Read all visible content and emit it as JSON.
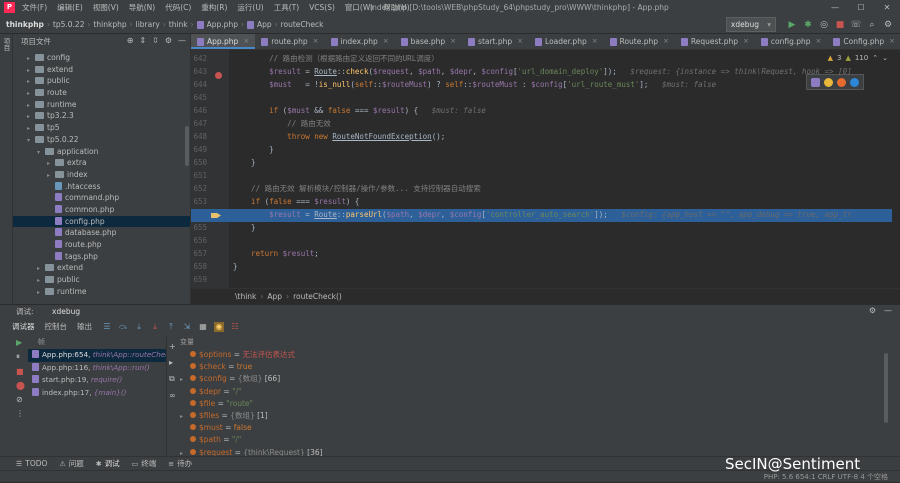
{
  "titlebar": {
    "menu": [
      "文件(F)",
      "编辑(E)",
      "视图(V)",
      "导航(N)",
      "代码(C)",
      "重构(R)",
      "运行(U)",
      "工具(T)",
      "VCS(S)",
      "窗口(W)",
      "帮助(H)"
    ],
    "title": "index.php [D:\\tools\\WEB\\phpStudy_64\\phpstudy_pro\\WWW\\thinkphp] - App.php",
    "min": "—",
    "max": "☐",
    "close": "✕"
  },
  "navbar": {
    "crumbs": [
      "thinkphp",
      "tp5.0.22",
      "thinkphp",
      "library",
      "think",
      "App.php",
      "App",
      "routeCheck"
    ],
    "config": "xdebug"
  },
  "project": {
    "label": "项目文件",
    "tree": [
      {
        "indent": 1,
        "name": "config",
        "type": "folder",
        "arrow": "▸"
      },
      {
        "indent": 1,
        "name": "extend",
        "type": "folder",
        "arrow": "▸"
      },
      {
        "indent": 1,
        "name": "public",
        "type": "folder",
        "arrow": "▸"
      },
      {
        "indent": 1,
        "name": "route",
        "type": "folder",
        "arrow": "▸"
      },
      {
        "indent": 1,
        "name": "runtime",
        "type": "folder",
        "arrow": "▸"
      },
      {
        "indent": 1,
        "name": "tp3.2.3",
        "type": "folder",
        "arrow": "▸"
      },
      {
        "indent": 1,
        "name": "tp5",
        "type": "folder",
        "arrow": "▸"
      },
      {
        "indent": 1,
        "name": "tp5.0.22",
        "type": "folder",
        "arrow": "▾"
      },
      {
        "indent": 2,
        "name": "application",
        "type": "folder",
        "arrow": "▾"
      },
      {
        "indent": 3,
        "name": "extra",
        "type": "folder",
        "arrow": "▸"
      },
      {
        "indent": 3,
        "name": "index",
        "type": "folder",
        "arrow": "▸"
      },
      {
        "indent": 3,
        "name": ".htaccess",
        "type": "file",
        "arrow": ""
      },
      {
        "indent": 3,
        "name": "command.php",
        "type": "php",
        "arrow": ""
      },
      {
        "indent": 3,
        "name": "common.php",
        "type": "php",
        "arrow": ""
      },
      {
        "indent": 3,
        "name": "config.php",
        "type": "php",
        "arrow": "",
        "selected": true
      },
      {
        "indent": 3,
        "name": "database.php",
        "type": "php",
        "arrow": ""
      },
      {
        "indent": 3,
        "name": "route.php",
        "type": "php",
        "arrow": ""
      },
      {
        "indent": 3,
        "name": "tags.php",
        "type": "php",
        "arrow": ""
      },
      {
        "indent": 2,
        "name": "extend",
        "type": "folder",
        "arrow": "▸"
      },
      {
        "indent": 2,
        "name": "public",
        "type": "folder",
        "arrow": "▸"
      },
      {
        "indent": 2,
        "name": "runtime",
        "type": "folder",
        "arrow": "▸"
      }
    ]
  },
  "tabs": [
    "App.php",
    "route.php",
    "index.php",
    "base.php",
    "start.php",
    "Loader.php",
    "Route.php",
    "Request.php",
    "config.php",
    "Config.php"
  ],
  "editor": {
    "inspect": {
      "warn": "3",
      "weak": "110"
    },
    "line_numbers": [
      "642",
      "643",
      "644",
      "645",
      "646",
      "647",
      "648",
      "649",
      "650",
      "651",
      "652",
      "653",
      "654",
      "655",
      "656",
      "657",
      "658",
      "659"
    ],
    "lines": [
      [
        {
          "c": "cmt",
          "t": "        // 路由检测（根据路由定义返回不同的URL调度）"
        }
      ],
      [
        {
          "c": "var",
          "t": "        $result"
        },
        {
          "c": "",
          "t": " = "
        },
        {
          "c": "cls",
          "t": "Route"
        },
        {
          "c": "",
          "t": "::"
        },
        {
          "c": "fn",
          "t": "check"
        },
        {
          "c": "",
          "t": "("
        },
        {
          "c": "var",
          "t": "$request"
        },
        {
          "c": "",
          "t": ", "
        },
        {
          "c": "var",
          "t": "$path"
        },
        {
          "c": "",
          "t": ", "
        },
        {
          "c": "var",
          "t": "$depr"
        },
        {
          "c": "",
          "t": ", "
        },
        {
          "c": "var",
          "t": "$config"
        },
        {
          "c": "",
          "t": "["
        },
        {
          "c": "str",
          "t": "'url_domain_deploy'"
        },
        {
          "c": "",
          "t": "]);   "
        },
        {
          "c": "hint",
          "t": "$request: {instance => think\\Request, hook => [0]"
        }
      ],
      [
        {
          "c": "var",
          "t": "        $must"
        },
        {
          "c": "",
          "t": "   = !"
        },
        {
          "c": "fn",
          "t": "is_null"
        },
        {
          "c": "",
          "t": "("
        },
        {
          "c": "kw",
          "t": "self"
        },
        {
          "c": "",
          "t": "::"
        },
        {
          "c": "var",
          "t": "$routeMust"
        },
        {
          "c": "",
          "t": ") ? "
        },
        {
          "c": "kw",
          "t": "self"
        },
        {
          "c": "",
          "t": "::"
        },
        {
          "c": "var",
          "t": "$routeMust"
        },
        {
          "c": "",
          "t": " : "
        },
        {
          "c": "var",
          "t": "$config"
        },
        {
          "c": "",
          "t": "["
        },
        {
          "c": "str",
          "t": "'url_route_must'"
        },
        {
          "c": "",
          "t": "];   "
        },
        {
          "c": "hint",
          "t": "$must: false"
        }
      ],
      [
        {
          "c": "",
          "t": ""
        }
      ],
      [
        {
          "c": "kw",
          "t": "        if"
        },
        {
          "c": "",
          "t": " ("
        },
        {
          "c": "var",
          "t": "$must"
        },
        {
          "c": "",
          "t": " && "
        },
        {
          "c": "kw",
          "t": "false"
        },
        {
          "c": "",
          "t": " === "
        },
        {
          "c": "var",
          "t": "$result"
        },
        {
          "c": "",
          "t": ") {   "
        },
        {
          "c": "hint",
          "t": "$must: false"
        }
      ],
      [
        {
          "c": "cmt",
          "t": "            // 路由无效"
        }
      ],
      [
        {
          "c": "kw",
          "t": "            throw new"
        },
        {
          "c": "",
          "t": " "
        },
        {
          "c": "cls",
          "t": "RouteNotFoundException"
        },
        {
          "c": "",
          "t": "();"
        }
      ],
      [
        {
          "c": "",
          "t": "        }"
        }
      ],
      [
        {
          "c": "",
          "t": "    }"
        }
      ],
      [
        {
          "c": "",
          "t": ""
        }
      ],
      [
        {
          "c": "cmt",
          "t": "    // 路由无效 解析模块/控制器/操作/参数... 支持控制器自动搜索"
        }
      ],
      [
        {
          "c": "kw",
          "t": "    if"
        },
        {
          "c": "",
          "t": " ("
        },
        {
          "c": "kw",
          "t": "false"
        },
        {
          "c": "",
          "t": " === "
        },
        {
          "c": "var",
          "t": "$result"
        },
        {
          "c": "",
          "t": ") {"
        }
      ],
      [
        {
          "c": "var",
          "t": "        $result"
        },
        {
          "c": "",
          "t": " = "
        },
        {
          "c": "cls",
          "t": "Route"
        },
        {
          "c": "",
          "t": "::"
        },
        {
          "c": "fn",
          "t": "parseUrl"
        },
        {
          "c": "",
          "t": "("
        },
        {
          "c": "var",
          "t": "$path"
        },
        {
          "c": "",
          "t": ", "
        },
        {
          "c": "var",
          "t": "$depr"
        },
        {
          "c": "",
          "t": ", "
        },
        {
          "c": "var",
          "t": "$config"
        },
        {
          "c": "",
          "t": "["
        },
        {
          "c": "str",
          "t": "'controller_auto_search'"
        },
        {
          "c": "",
          "t": "]);   "
        },
        {
          "c": "hintv",
          "t": "$config: {app_host => \"\", app_debug => true, app_tr"
        }
      ],
      [
        {
          "c": "",
          "t": "    }"
        }
      ],
      [
        {
          "c": "",
          "t": ""
        }
      ],
      [
        {
          "c": "kw",
          "t": "    return"
        },
        {
          "c": "",
          "t": " "
        },
        {
          "c": "var",
          "t": "$result"
        },
        {
          "c": "",
          "t": ";"
        }
      ],
      [
        {
          "c": "",
          "t": "}"
        }
      ],
      [
        {
          "c": "",
          "t": ""
        }
      ]
    ],
    "breadcrumb": [
      "\\think",
      "App",
      "routeCheck()"
    ]
  },
  "debug": {
    "label": "调试:",
    "session": "xdebug",
    "tool_tabs": [
      "调试器",
      "控制台",
      "输出"
    ],
    "frames_header": "帧",
    "frames": [
      {
        "loc": "App.php:654, ",
        "fn": "think\\App::routeCheck()",
        "selected": true
      },
      {
        "loc": "App.php:116, ",
        "fn": "think\\App::run()"
      },
      {
        "loc": "start.php:19, ",
        "fn": "require()"
      },
      {
        "loc": "index.php:17, ",
        "fn": "{main}()"
      }
    ],
    "vars_header": "变量",
    "vars": [
      {
        "expand": "",
        "name": "$options",
        "eq": " = ",
        "val": "无法评估表达式",
        "cls": "err"
      },
      {
        "expand": "",
        "name": "$check",
        "eq": " = ",
        "val": "true",
        "cls": "bool"
      },
      {
        "expand": "▸",
        "name": "$config",
        "eq": " = ",
        "type": "{数组} ",
        "val": "[66]",
        "cls": "arr"
      },
      {
        "expand": "",
        "name": "$depr",
        "eq": " = ",
        "val": "\"/\"",
        "cls": ""
      },
      {
        "expand": "",
        "name": "$file",
        "eq": " = ",
        "val": "\"route\"",
        "cls": ""
      },
      {
        "expand": "▸",
        "name": "$files",
        "eq": " = ",
        "type": "{数组} ",
        "val": "[1]",
        "cls": "arr"
      },
      {
        "expand": "",
        "name": "$must",
        "eq": " = ",
        "val": "false",
        "cls": "bool"
      },
      {
        "expand": "",
        "name": "$path",
        "eq": " = ",
        "val": "\"/\"",
        "cls": ""
      },
      {
        "expand": "▸",
        "name": "$request",
        "eq": " = ",
        "type": "{think\\Request} ",
        "val": "[36]",
        "cls": "arr"
      }
    ]
  },
  "bottom_tabs": [
    "TODO",
    "问题",
    "调试",
    "终端",
    "待办"
  ],
  "status": "PHP: 5.6   654:1   CRLF   UTF-8   4 个空格",
  "watermark": "SecIN@Sentiment"
}
